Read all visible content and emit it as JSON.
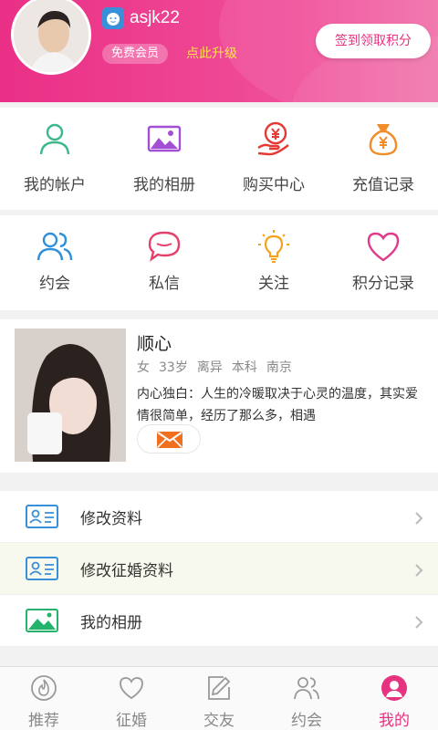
{
  "header": {
    "username": "asjk22",
    "member_badge": "免费会员",
    "upgrade_link": "点此升级",
    "sign_button": "签到领取积分"
  },
  "grid1": [
    {
      "label": "我的帐户",
      "icon": "user-icon",
      "color": "#3cb98a"
    },
    {
      "label": "我的相册",
      "icon": "album-icon",
      "color": "#a24fd6"
    },
    {
      "label": "购买中心",
      "icon": "yuan-hand-icon",
      "color": "#e53935"
    },
    {
      "label": "充值记录",
      "icon": "money-bag-icon",
      "color": "#f28c28"
    }
  ],
  "grid2": [
    {
      "label": "约会",
      "icon": "people-icon",
      "color": "#2f8fd8"
    },
    {
      "label": "私信",
      "icon": "chat-icon",
      "color": "#e5406a"
    },
    {
      "label": "关注",
      "icon": "lightbulb-icon",
      "color": "#f3a21b"
    },
    {
      "label": "积分记录",
      "icon": "heart-icon",
      "color": "#e03a8a"
    }
  ],
  "profile": {
    "name": "顺心",
    "gender": "女",
    "age": "33岁",
    "marital": "离异",
    "education": "本科",
    "city": "南京",
    "bio": "内心独白：人生的冷暖取决于心灵的温度，其实爱情很简单，经历了那么多，相遇"
  },
  "menu": [
    {
      "label": "修改资料",
      "icon": "id-card-icon"
    },
    {
      "label": "修改征婚资料",
      "icon": "id-card-icon"
    },
    {
      "label": "我的相册",
      "icon": "photo-icon"
    }
  ],
  "tabs": [
    {
      "label": "推荐",
      "icon": "flame-icon"
    },
    {
      "label": "征婚",
      "icon": "heart-outline-icon"
    },
    {
      "label": "交友",
      "icon": "edit-icon"
    },
    {
      "label": "约会",
      "icon": "people-icon"
    },
    {
      "label": "我的",
      "icon": "profile-icon",
      "active": true
    }
  ],
  "colors": {
    "brand": "#e6337f",
    "upgrade": "#ffe14d"
  }
}
